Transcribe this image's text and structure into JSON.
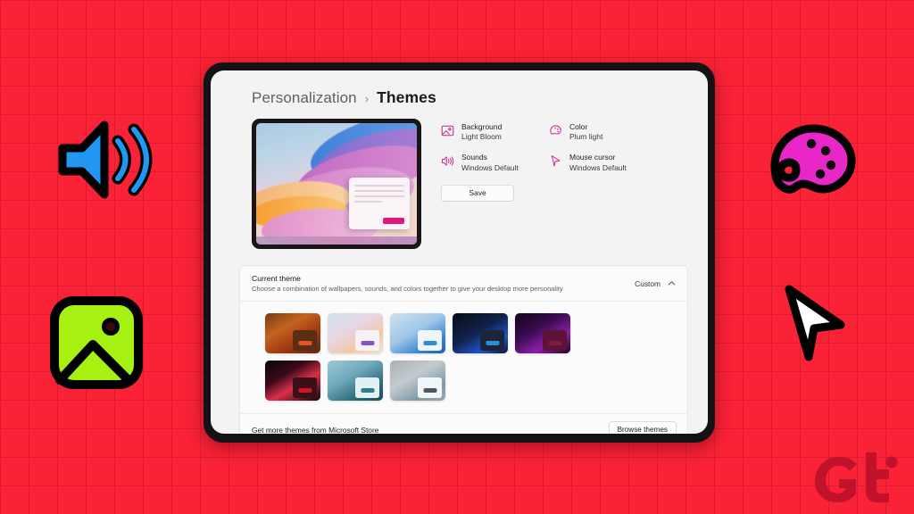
{
  "background": {
    "color": "#f92236",
    "grid_line_color": "#78081 6",
    "grid_spacing_px": 32
  },
  "decorations": [
    {
      "name": "speaker-icon",
      "label": "sound-speaker",
      "fill": "#2196f3"
    },
    {
      "name": "palette-icon",
      "label": "color-palette",
      "fill": "#e926c8"
    },
    {
      "name": "image-icon",
      "label": "picture-frame",
      "fill": "#a6f112"
    },
    {
      "name": "cursor-icon",
      "label": "mouse-pointer",
      "fill": "#ffffff"
    }
  ],
  "watermark": {
    "text": "Gt",
    "color": "#c0122a"
  },
  "settings": {
    "breadcrumb": {
      "parent": "Personalization",
      "separator": "›",
      "current": "Themes"
    },
    "preview": {
      "name": "theme-preview-monitor",
      "wallpaper": "Light Bloom bloom ribbons"
    },
    "properties": [
      {
        "icon": "image-icon",
        "title": "Background",
        "value": "Light Bloom"
      },
      {
        "icon": "palette-icon",
        "title": "Color",
        "value": "Plum light"
      },
      {
        "icon": "speaker-icon",
        "title": "Sounds",
        "value": "Windows Default"
      },
      {
        "icon": "cursor-icon",
        "title": "Mouse cursor",
        "value": "Windows Default"
      }
    ],
    "save_label": "Save",
    "accent_color": "#c7258f"
  },
  "current_theme_card": {
    "title": "Current theme",
    "subtitle": "Choose a combination of wallpapers, sounds, and colors together to give your desktop more personality",
    "selected_value": "Custom",
    "chevron": "collapse-chevron-up",
    "footer_text": "Get more themes from Microsoft Store",
    "browse_label": "Browse themes",
    "thumbnails": [
      {
        "name": "theme-thumb-autumn",
        "bg": "linear-gradient(150deg,#7a3a12 0%,#c2651f 35%,#a83f14 60%,#5a2a10 100%)",
        "win_bg": "#5a2d14",
        "pill": "#e0581f"
      },
      {
        "name": "theme-thumb-light-bloom",
        "bg": "linear-gradient(150deg,#cfe0ee 0%,#e8d6e4 40%,#f0c9a7 70%,#f5e0cf 100%)",
        "win_bg": "#f6f2f8",
        "pill": "#8257c8"
      },
      {
        "name": "theme-thumb-windows-light",
        "bg": "linear-gradient(150deg,#cfe2f0 0%,#9fc6e8 45%,#2f7fd0 80%,#1d5fae 100%)",
        "win_bg": "#eef5fb",
        "pill": "#2b8fd6"
      },
      {
        "name": "theme-thumb-windows-dark",
        "bg": "linear-gradient(150deg,#070c18 0%,#11224a 45%,#1f52c8 75%,#0a1430 100%)",
        "win_bg": "#1b2438",
        "pill": "#2a8fe0"
      },
      {
        "name": "theme-thumb-glow",
        "bg": "linear-gradient(150deg,#12031a 0%,#3c0c52 40%,#8d1ea8 70%,#1a0520 100%)",
        "win_bg": "#5d1338",
        "pill": "#7d1a46"
      },
      {
        "name": "theme-thumb-flow",
        "bg": "linear-gradient(150deg,#0a0508 0%,#3a0a18 35%,#d8304a 60%,#120508 100%)",
        "win_bg": "#3a1018",
        "pill": "#d41226"
      },
      {
        "name": "theme-thumb-captured",
        "bg": "linear-gradient(150deg,#9ec8d8 0%,#6fa8bc 40%,#2c6b78 75%,#1b4a56 100%)",
        "win_bg": "#e3f1f5",
        "pill": "#2f7f8c"
      },
      {
        "name": "theme-thumb-wave",
        "bg": "linear-gradient(150deg,#a8b0b4 0%,#c3cbcf 40%,#7e9aa8 75%,#9aa8ae 100%)",
        "win_bg": "#f1f6f8",
        "pill": "#4a5a62"
      }
    ]
  }
}
